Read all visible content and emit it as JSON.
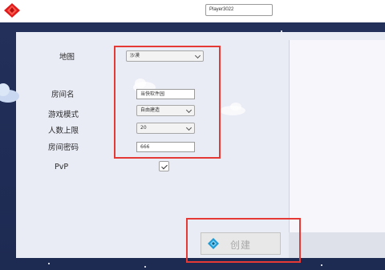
{
  "topbar": {
    "player_name": "Player3022"
  },
  "form": {
    "map_label": "地图",
    "map_value": "沙漠",
    "room_name_label": "房间名",
    "room_name_value": "当快软件园",
    "game_mode_label": "游戏模式",
    "game_mode_value": "自由建造",
    "max_players_label": "人数上限",
    "max_players_value": "20",
    "password_label": "房间密码",
    "password_value": "666",
    "pvp_label": "PvP",
    "pvp_checked": true
  },
  "create_button": {
    "label": "创建"
  },
  "colors": {
    "background": "#1e2a4d",
    "panel": "#e9ebf5",
    "highlight": "#e53935",
    "logo": "#e01b1b",
    "gem": "#1e9bd6"
  }
}
